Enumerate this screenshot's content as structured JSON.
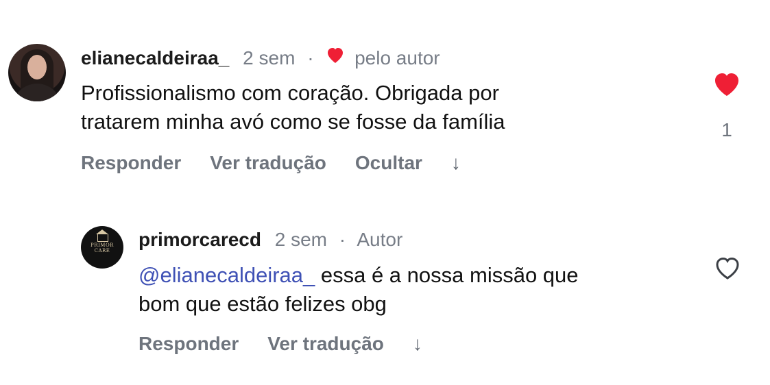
{
  "colors": {
    "like_red": "#ef1f35",
    "meta_gray": "#777d87",
    "action_gray": "#6e747d",
    "mention_blue": "#3f51b5"
  },
  "comments": [
    {
      "username": "elianecaldeiraa_",
      "time": "2 sem",
      "separator": "·",
      "liked_by_author_label": "pelo autor",
      "text_line_1": "Profissionalismo com coração. Obrigada por",
      "text_line_2": "tratarem minha avó como se fosse da família",
      "actions": {
        "reply": "Responder",
        "translate": "Ver tradução",
        "hide": "Ocultar"
      },
      "like_count": "1",
      "icons": {
        "avatar": "profile-avatar",
        "author_like": "heart-icon",
        "like": "filled-heart-icon",
        "expand": "down-arrow-icon"
      }
    },
    {
      "username": "primorcarecd",
      "time": "2 sem",
      "separator": "·",
      "author_badge": "Autor",
      "mention": "@elianecaldeiraa_",
      "text_line_1_rest": " essa é a nossa missão que",
      "text_line_2": "bom que estão felizes obg",
      "avatar_logo": {
        "line_1": "PRIMOR",
        "line_2": "CARE"
      },
      "actions": {
        "reply": "Responder",
        "translate": "Ver tradução"
      },
      "icons": {
        "avatar": "brand-avatar",
        "like": "outline-heart-icon",
        "expand": "down-arrow-icon"
      }
    }
  ]
}
